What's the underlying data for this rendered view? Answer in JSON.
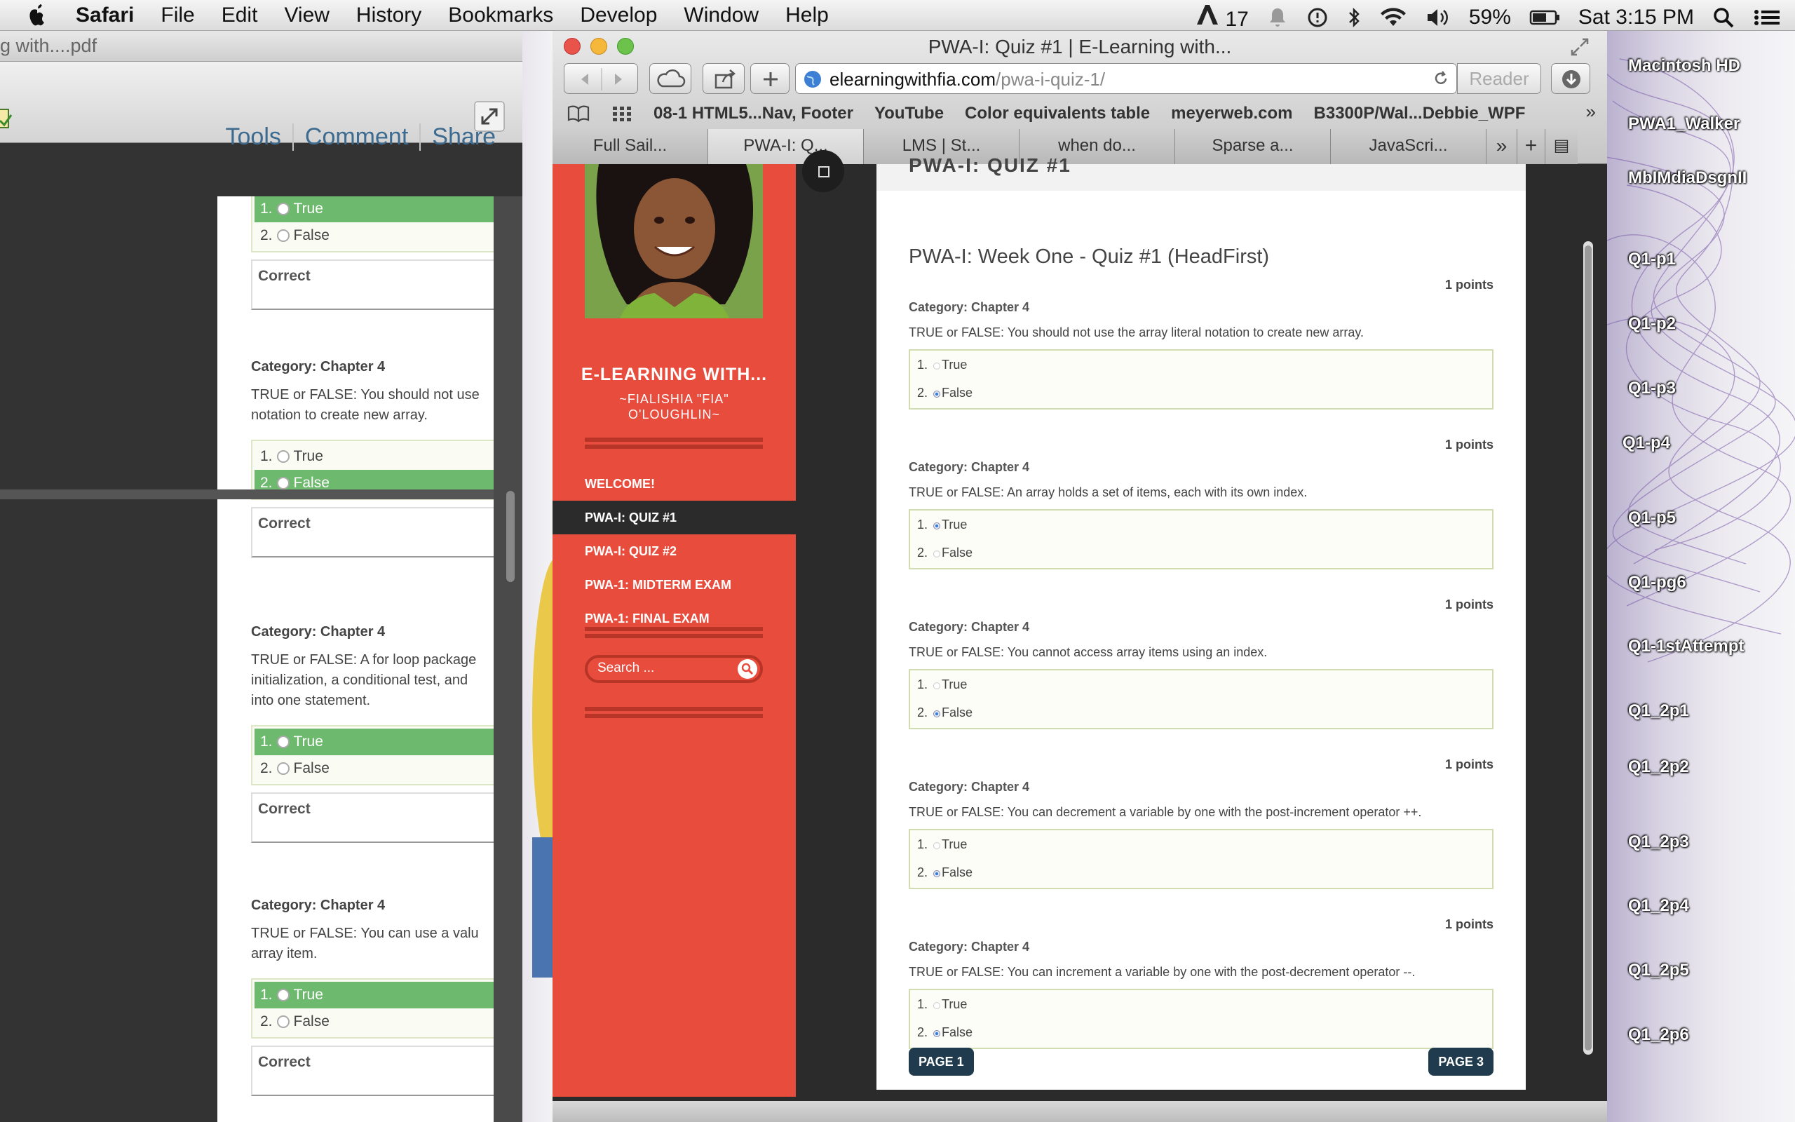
{
  "menubar": {
    "app": "Safari",
    "menus": [
      "File",
      "Edit",
      "View",
      "History",
      "Bookmarks",
      "Develop",
      "Window",
      "Help"
    ],
    "adobe_count": "17",
    "battery": "59%",
    "clock": "Sat 3:15 PM"
  },
  "pdf": {
    "title": "g with....pdf",
    "actions": [
      "Tools",
      "Comment",
      "Share"
    ],
    "questions": [
      {
        "category": "",
        "text": "",
        "options": [
          "True",
          "False"
        ],
        "selected": 0,
        "result": "Correct"
      },
      {
        "category": "Category: Chapter 4",
        "text": "TRUE or FALSE:  You should not use\nnotation to create new array.",
        "options": [
          "True",
          "False"
        ],
        "selected": 1,
        "result": "Correct"
      },
      {
        "category": "Category: Chapter 4",
        "text": "TRUE or FALSE:  A for loop package\ninitialization, a conditional test, and\ninto one statement.",
        "options": [
          "True",
          "False"
        ],
        "selected": 0,
        "result": "Correct"
      },
      {
        "category": "Category: Chapter 4",
        "text": "TRUE or FALSE:  You can use a valu\narray item.",
        "options": [
          "True",
          "False"
        ],
        "selected": 0,
        "result": "Correct"
      }
    ]
  },
  "safari": {
    "window_title": "PWA-I: Quiz #1 | E-Learning with...",
    "url_domain": "elearningwithfia.com",
    "url_path": "/pwa-i-quiz-1/",
    "reader": "Reader",
    "bookmarks": [
      "08-1 HTML5...Nav, Footer",
      "YouTube",
      "Color equivalents table",
      "meyerweb.com",
      "B3300P/Wal...Debbie_WPF"
    ],
    "tabs": [
      "Full Sail...",
      "PWA-I: Q...",
      "LMS | St...",
      "when do...",
      "Sparse a...",
      "JavaScri..."
    ]
  },
  "site": {
    "name": "E-LEARNING WITH...",
    "tagline": "~FIALISHIA \"FIA\" O'LOUGHLIN~",
    "nav": [
      "WELCOME!",
      "PWA-I: QUIZ #1",
      "PWA-I: QUIZ #2",
      "PWA-1: MIDTERM EXAM",
      "PWA-1: FINAL EXAM"
    ],
    "search_placeholder": "Search ...",
    "page_title": "PWA-I: QUIZ #1",
    "quiz_title": "PWA-I: Week One - Quiz #1 (HeadFirst)",
    "questions": [
      {
        "points": "1 points",
        "category": "Category: Chapter 4",
        "text": "TRUE or FALSE:  You should not use the array literal notation to create new array.",
        "options": [
          "True",
          "False"
        ],
        "selected": 1
      },
      {
        "points": "1 points",
        "category": "Category: Chapter 4",
        "text": "TRUE or FALSE:  An array holds a set of items, each with its own index.",
        "options": [
          "True",
          "False"
        ],
        "selected": 0
      },
      {
        "points": "1 points",
        "category": "Category: Chapter 4",
        "text": "TRUE or FALSE:  You cannot access array items using an index.",
        "options": [
          "True",
          "False"
        ],
        "selected": 1
      },
      {
        "points": "1 points",
        "category": "Category: Chapter 4",
        "text": "TRUE or FALSE:  You can decrement a variable by one with the post-increment operator ++.",
        "options": [
          "True",
          "False"
        ],
        "selected": 1
      },
      {
        "points": "1 points",
        "category": "Category: Chapter 4",
        "text": "TRUE or FALSE:  You can increment a variable by one with the post-decrement operator --.",
        "options": [
          "True",
          "False"
        ],
        "selected": 1
      }
    ],
    "prev_button": "PAGE 1",
    "next_button": "PAGE 3"
  },
  "desktop": {
    "icons": [
      "Macintosh HD",
      "PWA1_Walker",
      "MbIMdiaDsgnII",
      "Q1-p1",
      "Q1-p2",
      "Q1-p3",
      "Q1-p4",
      "Q1-p5",
      "Q1-pg6",
      "Q1-1stAttempt",
      "Q1_2p1",
      "Q1_2p2",
      "Q1_2p3",
      "Q1_2p4",
      "Q1_2p5",
      "Q1_2p6"
    ]
  },
  "colors": {
    "sidebar_red": "#e74c3c",
    "button_navy": "#1f3b4d",
    "answer_green": "#6db96d"
  }
}
